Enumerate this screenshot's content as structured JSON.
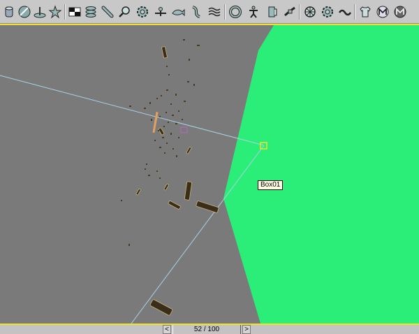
{
  "toolbar": {
    "buttons": [
      {
        "name": "tube-icon"
      },
      {
        "name": "sphere-icon"
      },
      {
        "name": "pin-icon"
      },
      {
        "name": "star-icon"
      },
      {
        "name": "checker-icon"
      },
      {
        "name": "spring-icon"
      },
      {
        "name": "pen-icon"
      },
      {
        "name": "magnifier-icon"
      },
      {
        "name": "gear-icon"
      },
      {
        "name": "pivot-icon"
      },
      {
        "name": "fish-icon"
      },
      {
        "name": "ribbon-icon"
      },
      {
        "name": "waves-icon"
      },
      {
        "name": "torus-icon"
      },
      {
        "name": "figure-icon"
      },
      {
        "name": "cylinder-icon"
      },
      {
        "name": "tilt-icon"
      },
      {
        "name": "wheel-icon"
      },
      {
        "name": "wave-line-icon"
      },
      {
        "name": "shirt-icon"
      },
      {
        "name": "material-m-icon"
      },
      {
        "name": "material-m-dark-icon"
      }
    ]
  },
  "viewport": {
    "background_color": "#7a7a7a",
    "ground_plane_color": "#2bee78",
    "active_border_color": "#f2e02a",
    "object_tooltip": "Box01"
  },
  "timeline": {
    "prev_label": "<",
    "next_label": ">",
    "frame_label": "52 / 100"
  }
}
